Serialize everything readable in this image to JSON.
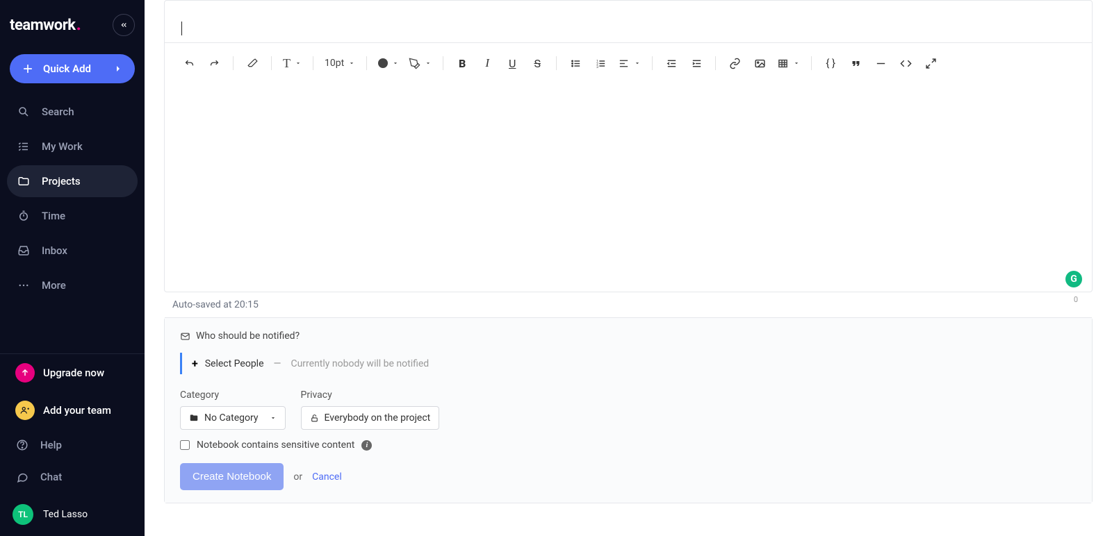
{
  "brand": "teamwork",
  "sidebar": {
    "quick_add": "Quick Add",
    "items": [
      {
        "label": "Search"
      },
      {
        "label": "My Work"
      },
      {
        "label": "Projects"
      },
      {
        "label": "Time"
      },
      {
        "label": "Inbox"
      },
      {
        "label": "More"
      }
    ],
    "upgrade": "Upgrade now",
    "add_team": "Add your team",
    "help": "Help",
    "chat": "Chat",
    "user_initials": "TL",
    "user_name": "Ted Lasso"
  },
  "editor": {
    "font_size": "10pt",
    "autosave": "Auto-saved at 20:15",
    "char_count": "0",
    "grammarly_badge": "G"
  },
  "notify": {
    "header": "Who should be notified?",
    "select_label": "Select People",
    "dash": "—",
    "hint": "Currently nobody will be notified"
  },
  "form": {
    "category_label": "Category",
    "category_value": "No Category",
    "privacy_label": "Privacy",
    "privacy_value": "Everybody on the project",
    "sensitive_label": "Notebook contains sensitive content",
    "create_btn": "Create Notebook",
    "or": "or",
    "cancel": "Cancel"
  }
}
